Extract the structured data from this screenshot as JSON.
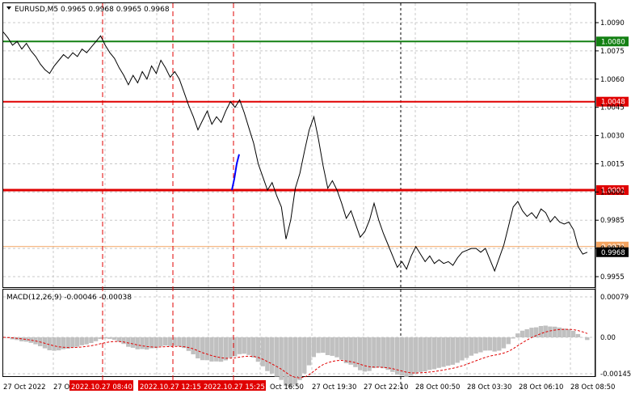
{
  "header": {
    "symbol_label": "EURUSD,M5",
    "ohlc_label": "0.9965 0.9968 0.9965 0.9968"
  },
  "price_pane": {
    "axis_ticks": [
      "1.0090",
      "1.0075",
      "1.0060",
      "1.0045",
      "1.0030",
      "1.0015",
      "1.0000",
      "0.9985",
      "0.9970",
      "0.9955"
    ],
    "levels": [
      {
        "label": "1.0080",
        "value": 1.008,
        "color": "#138013"
      },
      {
        "label": "1.0048",
        "value": 1.0048,
        "color": "#e00000"
      },
      {
        "label": "1.0001",
        "value": 1.0001,
        "color": "#e00000"
      },
      {
        "label": "0.9971",
        "value": 0.9971,
        "color": "#f4a460"
      }
    ],
    "current_price_label": "0.9968",
    "current_price": 0.9968
  },
  "macd_pane": {
    "title": "MACD(12,26,9) -0.00046 -0.00038",
    "axis_ticks": [
      "0.00079",
      "0.00",
      "-0.00145"
    ]
  },
  "time_axis": {
    "labels": [
      "27 Oct 2022",
      "27 O",
      "2022.10.27 08:40",
      "2022.10.27 12:15",
      "2022.10.27 15:25",
      "Oct 16:50",
      "27 Oct 19:30",
      "27 Oct 22:10",
      "28 Oct 00:50",
      "28 Oct 03:30",
      "28 Oct 06:10",
      "28 Oct 08:50"
    ]
  },
  "colors": {
    "grid": "#c8c8c8",
    "price_line": "#000000",
    "signal_marker": "#0000ff",
    "event_line": "#e00000",
    "macd_hist": "#c0c0c0",
    "macd_signal": "#e00000",
    "current_price_bg": "#000000"
  },
  "chart_data": {
    "type": "line",
    "title": "EURUSD,M5",
    "ylim": [
      0.99535,
      1.00945
    ],
    "series": [
      {
        "values": [
          1.0085,
          1.0082,
          1.0078,
          1.008,
          1.0076,
          1.0079,
          1.0075,
          1.0072,
          1.0068,
          1.0065,
          1.0063,
          1.0067,
          1.007,
          1.0073,
          1.0071,
          1.0074,
          1.0072,
          1.0076,
          1.0074,
          1.0077,
          1.008,
          1.0083,
          1.0078,
          1.0074,
          1.0071,
          1.0066,
          1.0062,
          1.0057,
          1.0062,
          1.0058,
          1.0064,
          1.006,
          1.0067,
          1.0063,
          1.007,
          1.0066,
          1.0061,
          1.0064,
          1.006,
          1.0053,
          1.0046,
          1.004,
          1.0033,
          1.0038,
          1.0043,
          1.0036,
          1.004,
          1.0037,
          1.0043,
          1.0048,
          1.0045,
          1.0049,
          1.0042,
          1.0034,
          1.0026,
          1.0015,
          1.0008,
          1.0001,
          1.0005,
          0.9998,
          0.9992,
          0.9975,
          0.9985,
          1.0002,
          1.001,
          1.0022,
          1.0033,
          1.004,
          1.0028,
          1.0014,
          1.0002,
          1.0006,
          1.0001,
          0.9994,
          0.9986,
          0.999,
          0.9983,
          0.9976,
          0.9979,
          0.9985,
          0.9994,
          0.9985,
          0.9978,
          0.9972,
          0.9966,
          0.996,
          0.9963,
          0.9959,
          0.9966,
          0.9971,
          0.9967,
          0.9963,
          0.9966,
          0.9962,
          0.9964,
          0.9962,
          0.9963,
          0.9961,
          0.9965,
          0.9968,
          0.9969,
          0.997,
          0.997,
          0.9968,
          0.997,
          0.9964,
          0.9958,
          0.9965,
          0.9972,
          0.9982,
          0.9992,
          0.9995,
          0.999,
          0.9987,
          0.9989,
          0.9986,
          0.9991,
          0.9989,
          0.9984,
          0.9987,
          0.9984,
          0.9983,
          0.9984,
          0.998,
          0.9971,
          0.9967,
          0.9968
        ]
      },
      {
        "values": [
          1.0001,
          1.0007,
          1.0015,
          1.002
        ]
      }
    ]
  }
}
